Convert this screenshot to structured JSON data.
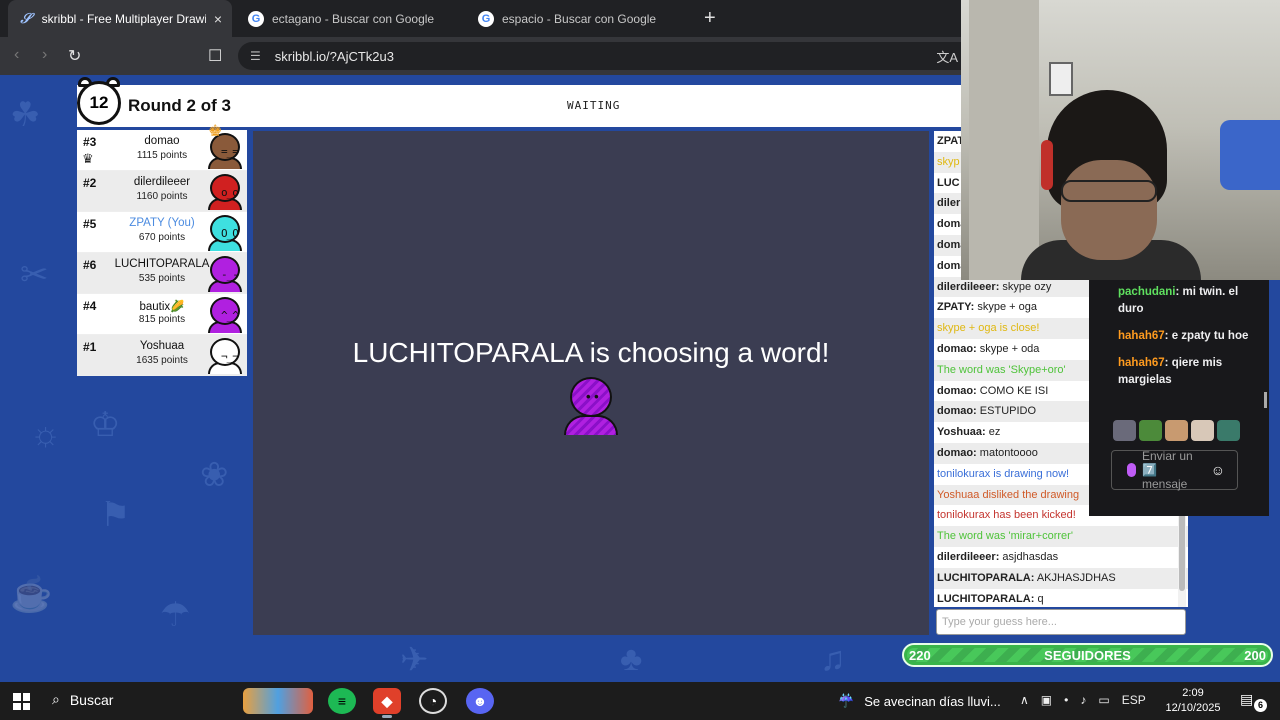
{
  "browser": {
    "tabs": [
      {
        "title": "skribbl - Free Multiplayer Drawin",
        "active": true,
        "icon": "skribbl-favicon"
      },
      {
        "title": "ectagano - Buscar con Google",
        "active": false,
        "icon": "google-favicon"
      },
      {
        "title": "espacio - Buscar con Google",
        "active": false,
        "icon": "google-favicon"
      }
    ],
    "new_tab": "+",
    "close_tab": "×",
    "url": "skribbl.io/?AjCTk2u3"
  },
  "game": {
    "timer": "12",
    "round": "Round 2 of 3",
    "status": "WAITING",
    "choosing_text": "LUCHITOPARALA is choosing a word!",
    "players": [
      {
        "rank": "#3",
        "name": "domao",
        "points": "1115 points",
        "me": false,
        "crown": true,
        "color": "#8a5a3a"
      },
      {
        "rank": "#2",
        "name": "dilerdileeer",
        "points": "1160 points",
        "me": false,
        "crown": false,
        "color": "#d02020"
      },
      {
        "rank": "#5",
        "name": "ZPATY (You)",
        "points": "670 points",
        "me": true,
        "crown": false,
        "color": "#3ee0e0"
      },
      {
        "rank": "#6",
        "name": "LUCHITOPARALA",
        "points": "535 points",
        "me": false,
        "crown": false,
        "color": "#b020e0"
      },
      {
        "rank": "#4",
        "name": "bautix🌽",
        "points": "815 points",
        "me": false,
        "crown": false,
        "color": "#b020e0"
      },
      {
        "rank": "#1",
        "name": "Yoshuaa",
        "points": "1635 points",
        "me": false,
        "crown": false,
        "color": "#ffffff"
      }
    ],
    "chat": [
      {
        "type": "user",
        "user": "ZPAT",
        "text": ""
      },
      {
        "type": "yellow",
        "user": "",
        "text": "skyp"
      },
      {
        "type": "user",
        "user": "LUC",
        "text": ""
      },
      {
        "type": "user",
        "user": "diler",
        "text": ""
      },
      {
        "type": "user",
        "user": "doma",
        "text": ""
      },
      {
        "type": "user",
        "user": "doma",
        "text": ""
      },
      {
        "type": "user",
        "user": "doma",
        "text": ""
      },
      {
        "type": "user",
        "user": "dilerdileeer:",
        "text": "skype ozy"
      },
      {
        "type": "user",
        "user": "ZPATY:",
        "text": "skype + oga"
      },
      {
        "type": "yellow",
        "user": "",
        "text": "skype + oga is close!"
      },
      {
        "type": "user",
        "user": "domao:",
        "text": "skype + oda"
      },
      {
        "type": "green",
        "user": "",
        "text": "The word was 'Skype+oro'"
      },
      {
        "type": "user",
        "user": "domao:",
        "text": "COMO KE ISI"
      },
      {
        "type": "user",
        "user": "domao:",
        "text": "ESTUPIDO"
      },
      {
        "type": "user",
        "user": "Yoshuaa:",
        "text": "ez"
      },
      {
        "type": "user",
        "user": "domao:",
        "text": "matontoooo"
      },
      {
        "type": "blue",
        "user": "",
        "text": "tonilokurax is drawing now!"
      },
      {
        "type": "orange",
        "user": "",
        "text": "Yoshuaa disliked the drawing"
      },
      {
        "type": "red",
        "user": "",
        "text": "tonilokurax has been kicked!"
      },
      {
        "type": "green",
        "user": "",
        "text": "The word was 'mirar+correr'"
      },
      {
        "type": "user",
        "user": "dilerdileeer:",
        "text": "asjdhasdas"
      },
      {
        "type": "user",
        "user": "LUCHITOPARALA:",
        "text": "AKJHASJDHAS"
      },
      {
        "type": "user",
        "user": "LUCHITOPARALA:",
        "text": "q"
      }
    ],
    "guess_placeholder": "Type your guess here..."
  },
  "stream": {
    "twitch_chat": [
      {
        "user": "pachudani",
        "text": "mi twin. el duro",
        "color": "green"
      },
      {
        "user": "hahah67",
        "text": "e zpaty tu hoe",
        "color": "orange"
      },
      {
        "user": "hahah67",
        "text": "qiere mis margielas",
        "color": "orange"
      }
    ],
    "send_placeholder": "Enviar un 7️⃣ mensaje",
    "followers_current": "220",
    "followers_label": "SEGUIDORES",
    "followers_goal": "200"
  },
  "taskbar": {
    "search": "Buscar",
    "weather": "Se avecinan días lluvi...",
    "language": "ESP",
    "time": "2:09",
    "date": "12/10/2025",
    "notifications": "6"
  }
}
